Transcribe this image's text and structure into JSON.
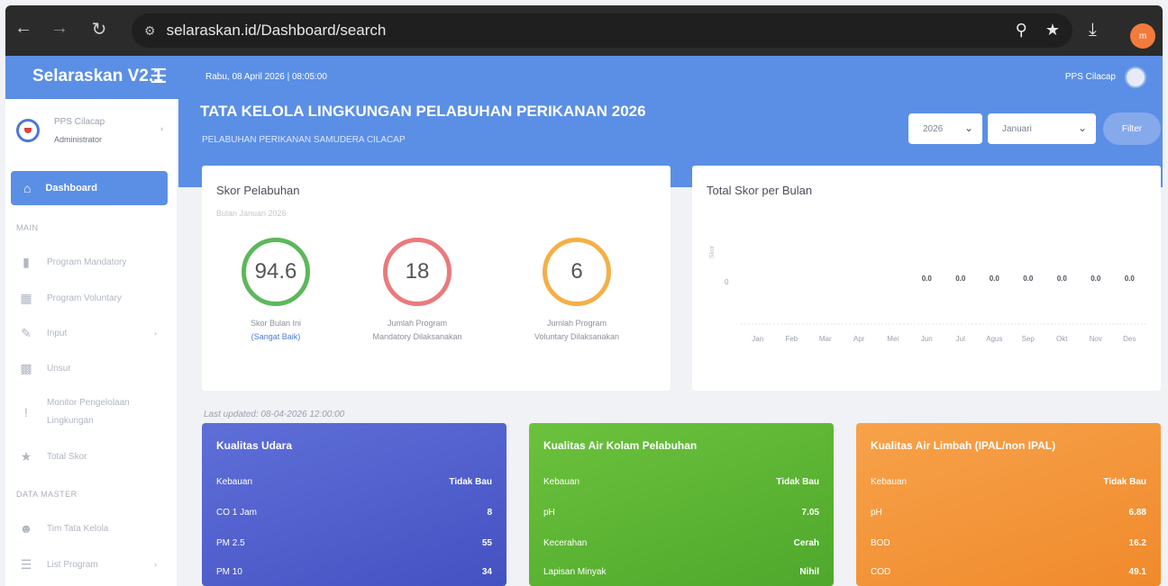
{
  "browser": {
    "url": "selaraskan.id/Dashboard/search",
    "avatar_initials": "m"
  },
  "app": {
    "brand": "Selaraskan V2.1",
    "date_line": "Rabu, 08 April 2026  |  08:05:00",
    "top_right_user": "PPS Cilacap"
  },
  "sidebar": {
    "profile_name": "PPS Cilacap",
    "profile_role": "Administrator",
    "dashboard_label": "Dashboard",
    "section_main": "MAIN",
    "items": [
      {
        "label": "Program Mandatory",
        "icon": "document-icon"
      },
      {
        "label": "Program Voluntary",
        "icon": "database-icon"
      },
      {
        "label": "Input",
        "icon": "edit-icon"
      },
      {
        "label": "Unsur",
        "icon": "video-icon"
      },
      {
        "label": "Monitor Pengelolaan Lingkungan",
        "icon": "exclamation-icon"
      },
      {
        "label": "Total Skor",
        "icon": "star-icon"
      }
    ],
    "section_master": "DATA MASTER",
    "master_items": [
      {
        "label": "Tim Tata Kelola",
        "icon": "users-icon"
      },
      {
        "label": "List Program",
        "icon": "list-icon"
      }
    ]
  },
  "header": {
    "title": "TATA KELOLA LINGKUNGAN PELABUHAN PERIKANAN 2026",
    "subtitle": "PELABUHAN PERIKANAN SAMUDERA CILACAP",
    "year_value": "2026",
    "month_value": "Januari",
    "filter_label": "Filter"
  },
  "skor": {
    "title": "Skor Pelabuhan",
    "period": "Bulan Januari 2026",
    "g1_value": "94.6",
    "g1_label": "Skor Bulan Ini",
    "g1_sub": "(Sangat Baik)",
    "g2_value": "18",
    "g2_label1": "Jumlah Program",
    "g2_label2": "Mandatory Dilaksanakan",
    "g3_value": "6",
    "g3_label1": "Jumlah Program",
    "g3_label2": "Voluntary Dilaksanakan",
    "updated": "Last updated: 08-04-2026 12:00:00"
  },
  "chart_data": {
    "type": "bar",
    "title": "Total Skor per Bulan",
    "ylabel": "Skor",
    "categories": [
      "Jan",
      "Feb",
      "Mar",
      "Apr",
      "Mei",
      "Jun",
      "Jul",
      "Agus",
      "Sep",
      "Okt",
      "Nov",
      "Des"
    ],
    "values": [
      null,
      null,
      null,
      null,
      null,
      0.0,
      0.0,
      0.0,
      0.0,
      0.0,
      0.0,
      0.0
    ],
    "data_labels": [
      "",
      "",
      "",
      "",
      "",
      "0.0",
      "0.0",
      "0.0",
      "0.0",
      "0.0",
      "0.0",
      "0.0"
    ],
    "y_tick": "0"
  },
  "colors": {
    "primary": "#5b8fe5",
    "gauge_green": "#5cb85c",
    "gauge_red": "#ea7a7d",
    "gauge_orange": "#f4b047"
  },
  "udara": {
    "title": "Kualitas Udara",
    "rows": [
      {
        "k": "Kebauan",
        "v": "Tidak Bau"
      },
      {
        "k": "CO 1 Jam",
        "v": "8"
      },
      {
        "k": "PM 2.5",
        "v": "55"
      },
      {
        "k": "PM 10",
        "v": "34"
      }
    ]
  },
  "kolam": {
    "title": "Kualitas Air Kolam Pelabuhan",
    "rows": [
      {
        "k": "Kebauan",
        "v": "Tidak Bau"
      },
      {
        "k": "pH",
        "v": "7.05"
      },
      {
        "k": "Kecerahan",
        "v": "Cerah"
      },
      {
        "k": "Lapisan Minyak",
        "v": "Nihil"
      }
    ]
  },
  "limbah": {
    "title": "Kualitas Air Limbah (IPAL/non IPAL)",
    "rows": [
      {
        "k": "Kebauan",
        "v": "Tidak Bau"
      },
      {
        "k": "pH",
        "v": "6.88"
      },
      {
        "k": "BOD",
        "v": "16.2"
      },
      {
        "k": "COD",
        "v": "49.1"
      }
    ]
  }
}
